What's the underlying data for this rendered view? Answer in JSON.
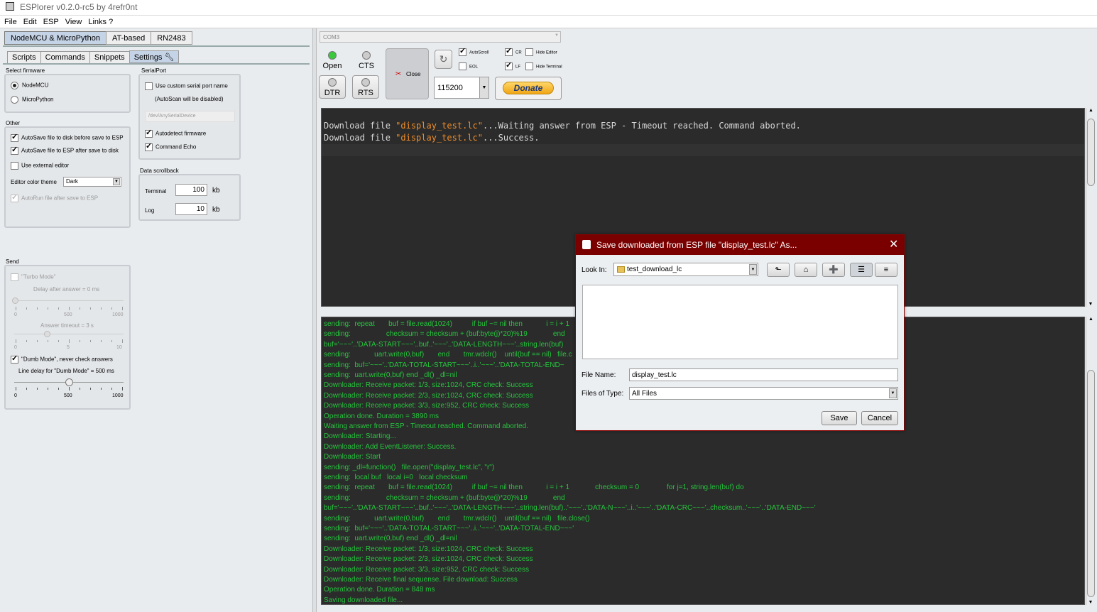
{
  "window": {
    "title": "ESPlorer v0.2.0-rc5 by 4refr0nt"
  },
  "menu": [
    "File",
    "Edit",
    "ESP",
    "View",
    "Links ?"
  ],
  "top_tabs": [
    "NodeMCU & MicroPython",
    "AT-based",
    "RN2483"
  ],
  "sub_tabs": [
    "Scripts",
    "Commands",
    "Snippets",
    "Settings"
  ],
  "settings": {
    "select_firmware": "Select firmware",
    "nodemcu": "NodeMCU",
    "micropython": "MicroPython",
    "other": "Other",
    "autosave_disk": "AutoSave file to disk before save to ESP",
    "autosave_esp": "AutoSave file to ESP after save to disk",
    "use_external_editor": "Use external editor",
    "editor_theme_label": "Editor color theme",
    "editor_theme_value": "Dark",
    "autorun": "AutoRun file after save to ESP",
    "serialport": "SerialPort",
    "custom_serial": "Use custom serial port name",
    "autoscan_disabled": "(AutoScan will be disabled)",
    "serial_device_placeholder": "/dev/AnySerialDevice",
    "autodetect": "Autodetect firmware",
    "command_echo": "Command Echo",
    "data_scrollback": "Data scrollback",
    "terminal_label": "Terminal",
    "terminal_value": "100",
    "log_label": "Log",
    "log_value": "10",
    "kb": "kb",
    "send": "Send",
    "turbo_mode": "\"Turbo Mode\"",
    "delay_after_answer": "Delay after answer = 0 ms",
    "answer_timeout": "Answer timeout = 3 s",
    "dumb_mode": "\"Dumb Mode\", never check answers",
    "line_delay": "Line delay for \"Dumb Mode\" = 500 ms",
    "slider1_labels": [
      "0",
      "500",
      "1000"
    ],
    "slider1_value": 0,
    "slider2_labels": [
      "0",
      "5",
      "10"
    ],
    "slider2_value": 3,
    "slider3_labels": [
      "0",
      "500",
      "1000"
    ],
    "slider3_value": 500
  },
  "port": {
    "name": "COM3",
    "baud": "115200"
  },
  "controls": {
    "open": "Open",
    "cts": "CTS",
    "dtr": "DTR",
    "rts": "RTS",
    "close": "Close",
    "autoscroll": "AutoScroll",
    "eol": "EOL",
    "cr": "CR",
    "lf": "LF",
    "hide_editor": "Hide Editor",
    "hide_terminal": "Hide Terminal",
    "donate": "Donate"
  },
  "colors": {
    "led_green": "#3cc83c",
    "accent_red": "#7a0000",
    "log_green": "#25c53d",
    "string_orange": "#f08c28"
  },
  "terminal": [
    {
      "pre": "Download file ",
      "str": "\"display_test.lc\"",
      "post": "...Waiting answer from ESP - Timeout reached. Command aborted."
    },
    {
      "pre": "Download file ",
      "str": "\"display_test.lc\"",
      "post": "...Success."
    }
  ],
  "log_lines": [
    "sending:  repeat       buf = file.read(1024)          if buf ~= nil then            i = i + 1",
    "sending:                  checksum = checksum + (buf:byte(j)*20)%19             end",
    "buf='~~~'..'DATA-START~~~'..buf..'~~~'..'DATA-LENGTH~~~'..string.len(buf)",
    "sending:            uart.write(0,buf)       end       tmr.wdclr()    until(buf == nil)   file.c",
    "sending:  buf='~~~'..'DATA-TOTAL-START~~~'..i..'~~~'..'DATA-TOTAL-END~",
    "sending:  uart.write(0,buf) end _dl() _dl=nil",
    "Downloader: Receive packet: 1/3, size:1024, CRC check: Success",
    "Downloader: Receive packet: 2/3, size:1024, CRC check: Success",
    "Downloader: Receive packet: 3/3, size:952, CRC check: Success",
    "Operation done. Duration = 3890 ms",
    "Waiting answer from ESP - Timeout reached. Command aborted.",
    "Downloader: Starting...",
    "Downloader: Add EventListener: Success.",
    "Downloader: Start",
    "sending: _dl=function()   file.open(\"display_test.lc\", \"r\")",
    "sending:  local buf   local i=0   local checksum",
    "sending:  repeat       buf = file.read(1024)          if buf ~= nil then            i = i + 1             checksum = 0              for j=1, string.len(buf) do",
    "sending:                  checksum = checksum + (buf:byte(j)*20)%19             end",
    "buf='~~~'..'DATA-START~~~'..buf..'~~~'..'DATA-LENGTH~~~'..string.len(buf)..'~~~'..'DATA-N~~~'..i..'~~~'..'DATA-CRC~~~'..checksum..'~~~'..'DATA-END~~~'",
    "sending:            uart.write(0,buf)       end       tmr.wdclr()    until(buf == nil)   file.close()",
    "sending:  buf='~~~'..'DATA-TOTAL-START~~~'..i..'~~~'..'DATA-TOTAL-END~~~'",
    "sending:  uart.write(0,buf) end _dl() _dl=nil",
    "Downloader: Receive packet: 1/3, size:1024, CRC check: Success",
    "Downloader: Receive packet: 2/3, size:1024, CRC check: Success",
    "Downloader: Receive packet: 3/3, size:952, CRC check: Success",
    "Downloader: Receive final sequense. File download: Success",
    "Operation done. Duration = 848 ms",
    "Saving downloaded file..."
  ],
  "dialog": {
    "title": "Save downloaded from ESP file \"display_test.lc\" As...",
    "look_in_label": "Look In:",
    "look_in_value": "test_download_lc",
    "file_name_label": "File Name:",
    "file_name_value": "display_test.lc",
    "files_type_label": "Files of Type:",
    "files_type_value": "All Files",
    "save": "Save",
    "cancel": "Cancel"
  }
}
